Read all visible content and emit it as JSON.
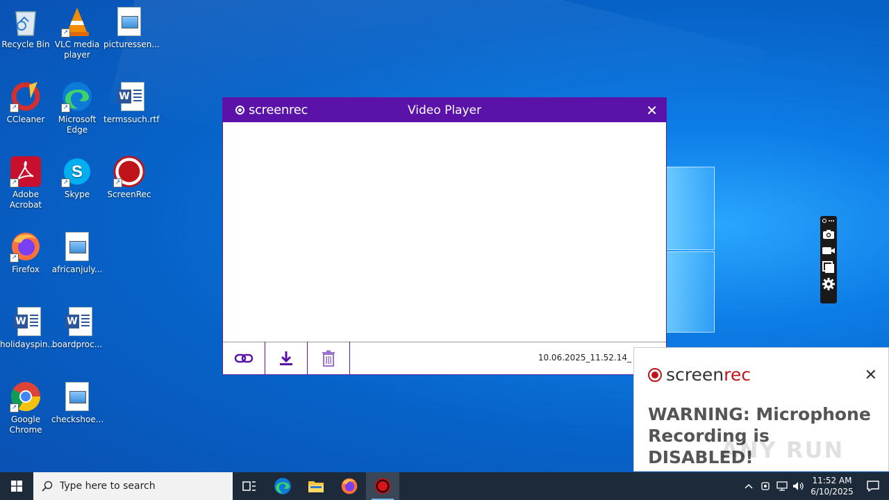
{
  "desktop": {
    "icons": [
      {
        "label": "Recycle Bin",
        "icon": "recycle-bin-icon"
      },
      {
        "label": "VLC media player",
        "icon": "vlc-icon"
      },
      {
        "label": "picturessen...",
        "icon": "image-file-icon"
      },
      {
        "label": "CCleaner",
        "icon": "ccleaner-icon"
      },
      {
        "label": "Microsoft Edge",
        "icon": "edge-icon"
      },
      {
        "label": "termssuch.rtf",
        "icon": "word-doc-icon"
      },
      {
        "label": "Adobe Acrobat",
        "icon": "acrobat-icon"
      },
      {
        "label": "Skype",
        "icon": "skype-icon"
      },
      {
        "label": "ScreenRec",
        "icon": "screenrec-icon"
      },
      {
        "label": "Firefox",
        "icon": "firefox-icon"
      },
      {
        "label": "africanjuly...",
        "icon": "image-file-icon"
      },
      {
        "label": "holidayspin...",
        "icon": "word-doc-icon"
      },
      {
        "label": "boardproc...",
        "icon": "word-doc-icon"
      },
      {
        "label": "Google Chrome",
        "icon": "chrome-icon"
      },
      {
        "label": "checkshoe...",
        "icon": "image-file-icon"
      }
    ]
  },
  "player": {
    "brand": "screenrec",
    "title": "Video Player",
    "close": "✕",
    "filename": "10.06.2025_11.52.14_",
    "tools": [
      "link-icon",
      "download-icon",
      "trash-icon"
    ]
  },
  "notification": {
    "brand_main": "screen",
    "brand_accent": "rec",
    "close": "✕",
    "message": "WARNING: Microphone Recording is DISABLED!",
    "watermark": "ANY RUN"
  },
  "taskbar": {
    "search_placeholder": "Type here to search",
    "time": "11:52 AM",
    "date": "6/10/2025"
  },
  "colors": {
    "brand_purple": "#5a12a8",
    "rec_red": "#c0141b",
    "taskbar": "#1c2a3a"
  }
}
